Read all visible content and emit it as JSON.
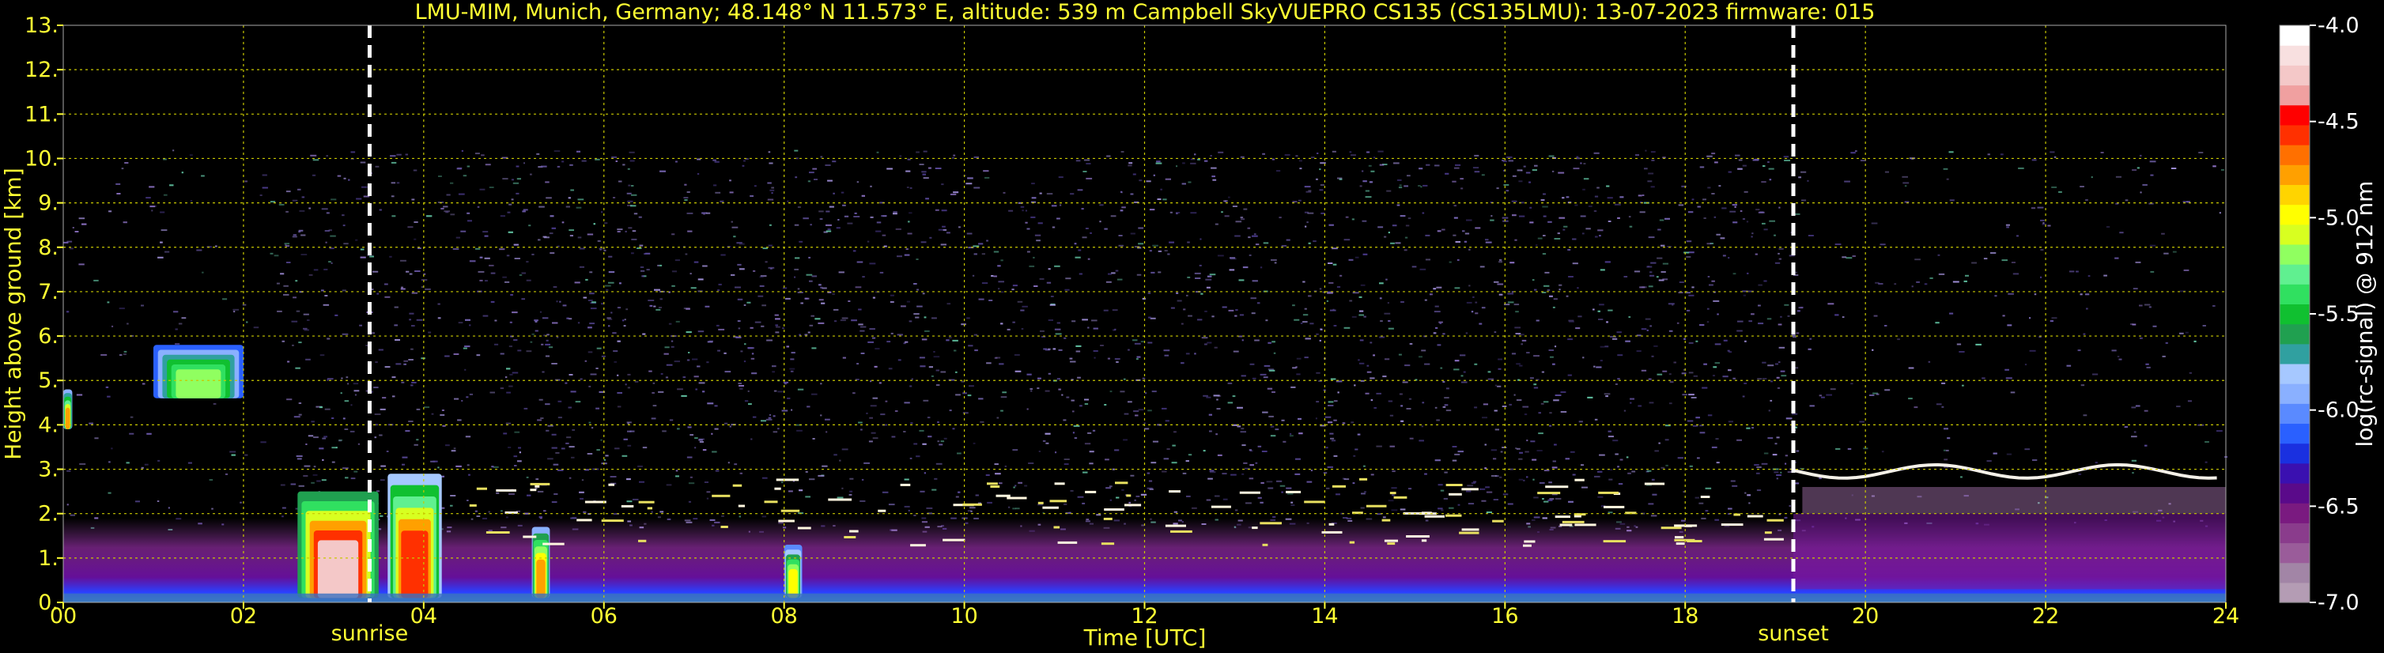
{
  "chart_data": {
    "type": "heatmap",
    "title": "LMU-MIM, Munich, Germany; 48.148° N 11.573° E, altitude: 539 m    Campbell SkyVUEPRO CS135 (CS135LMU): 13-07-2023    firmware: 015",
    "xlabel": "Time [UTC]",
    "ylabel": "Height above ground [km]",
    "xlim": [
      0,
      24
    ],
    "ylim": [
      0,
      13
    ],
    "x_tick_values": [
      0,
      2,
      4,
      6,
      8,
      10,
      12,
      14,
      16,
      18,
      20,
      22,
      24
    ],
    "x_tick_labels": [
      "00",
      "02",
      "04",
      "06",
      "08",
      "10",
      "12",
      "14",
      "16",
      "18",
      "20",
      "22",
      "24"
    ],
    "y_tick_values": [
      0,
      1,
      2,
      3,
      4,
      5,
      6,
      7,
      8,
      9,
      10,
      11,
      12,
      13
    ],
    "y_tick_labels": [
      "0.",
      "1.",
      "2.",
      "3.",
      "4.",
      "5.",
      "6.",
      "7.",
      "8.",
      "9.",
      "10.",
      "11.",
      "12.",
      "13."
    ],
    "grid": true,
    "colorbar": {
      "label": "log(rc-signal) @ 912 nm",
      "range": [
        -7.0,
        -4.0
      ],
      "tick_values": [
        -7.0,
        -6.5,
        -6.0,
        -5.5,
        -5.0,
        -4.5,
        -4.0
      ],
      "tick_labels": [
        "-7.0",
        "-6.5",
        "-6.0",
        "-5.5",
        "-5.0",
        "-4.5",
        "-4.0"
      ],
      "colors": [
        "#b49cb4",
        "#a285a6",
        "#9a5c9a",
        "#8a3c8c",
        "#7a1a80",
        "#5a0a8a",
        "#3a10b0",
        "#1a30e0",
        "#2a60ff",
        "#5a8aff",
        "#8ab0ff",
        "#a6c8ff",
        "#30a0a0",
        "#20a050",
        "#10c030",
        "#30e060",
        "#60f090",
        "#90ff60",
        "#d8ff20",
        "#ffff00",
        "#ffd400",
        "#ffa000",
        "#ff7000",
        "#ff3000",
        "#ff0000",
        "#f0a0a0",
        "#f4c8c8",
        "#f8e0e0",
        "#ffffff"
      ]
    },
    "annotations": [
      {
        "label": "sunrise",
        "x": 3.4
      },
      {
        "label": "sunset",
        "x": 19.2
      }
    ],
    "data_top_km": 10.2,
    "features": [
      {
        "kind": "aerosol_layer",
        "x": [
          0,
          24
        ],
        "y": [
          0,
          1.9
        ],
        "value": -6.3
      },
      {
        "kind": "cloud",
        "x": [
          2.6,
          3.5
        ],
        "y": [
          0.1,
          2.5
        ],
        "value": -4.0
      },
      {
        "kind": "cloud",
        "x": [
          3.6,
          4.2
        ],
        "y": [
          0.1,
          2.9
        ],
        "value": -4.3
      },
      {
        "kind": "cloud",
        "x": [
          5.2,
          5.4
        ],
        "y": [
          0.1,
          1.7
        ],
        "value": -4.5
      },
      {
        "kind": "cloud",
        "x": [
          8.0,
          8.2
        ],
        "y": [
          0.1,
          1.3
        ],
        "value": -4.8
      },
      {
        "kind": "cloud",
        "x": [
          1.0,
          2.0
        ],
        "y": [
          4.6,
          5.8
        ],
        "value": -5.0
      },
      {
        "kind": "cloud",
        "x": [
          0,
          0.1
        ],
        "y": [
          3.9,
          4.8
        ],
        "value": -4.6
      },
      {
        "kind": "boundary_layer_top",
        "x": [
          19.2,
          24
        ],
        "y": [
          2.8,
          3.1
        ],
        "value": -4.0
      }
    ]
  }
}
